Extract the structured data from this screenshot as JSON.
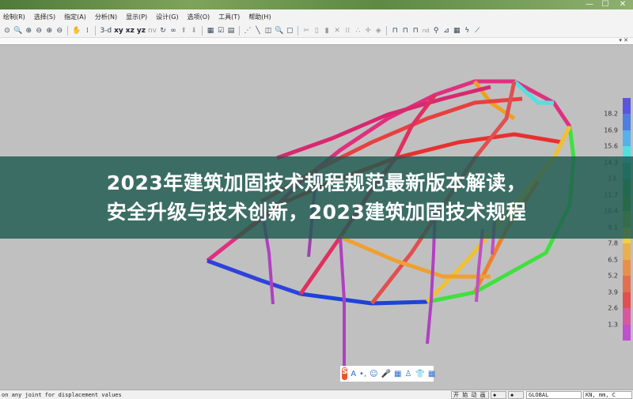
{
  "window": {
    "minimize": "—",
    "maximize": "☐",
    "close": "✕"
  },
  "menu": [
    "绘制(R)",
    "选择(S)",
    "指定(A)",
    "分析(N)",
    "显示(P)",
    "设计(G)",
    "选项(O)",
    "工具(T)",
    "帮助(H)"
  ],
  "toolbar": {
    "view_3d": "3-d",
    "view_xy": "xy",
    "view_xz": "xz",
    "view_yz": "yz",
    "view_nv": "nv",
    "nd": "nd"
  },
  "legend": {
    "labels": [
      "18.2",
      "16.9",
      "15.6",
      "14.3",
      "13.",
      "11.7",
      "10.4",
      "9.1",
      "7.8",
      "6.5",
      "5.2",
      "3.9",
      "2.6",
      "1.3"
    ],
    "colors": [
      "#5a55e0",
      "#4e7ee0",
      "#58b0e8",
      "#50e0e0",
      "#2ec0a0",
      "#30b050",
      "#50b030",
      "#90c030",
      "#f0d040",
      "#e8b050",
      "#e8904a",
      "#e07050",
      "#e05050",
      "#d858a0",
      "#c050d0"
    ]
  },
  "banner": {
    "line1": "2023年建筑加固技术规程规范最新版本解读，",
    "line2": "安全升级与技术创新，2023建筑加固技术规程"
  },
  "ime": {
    "logo": "S",
    "items": [
      "A",
      "•,",
      "☺",
      "🎤",
      "▦",
      "♙",
      "👕",
      "▦"
    ]
  },
  "status": {
    "message": "on any joint for displacement values",
    "animate": "开 始 动 画",
    "prev": "◆",
    "next": "◆",
    "coord": "GLOBAL",
    "units": "KN, mm, C"
  }
}
